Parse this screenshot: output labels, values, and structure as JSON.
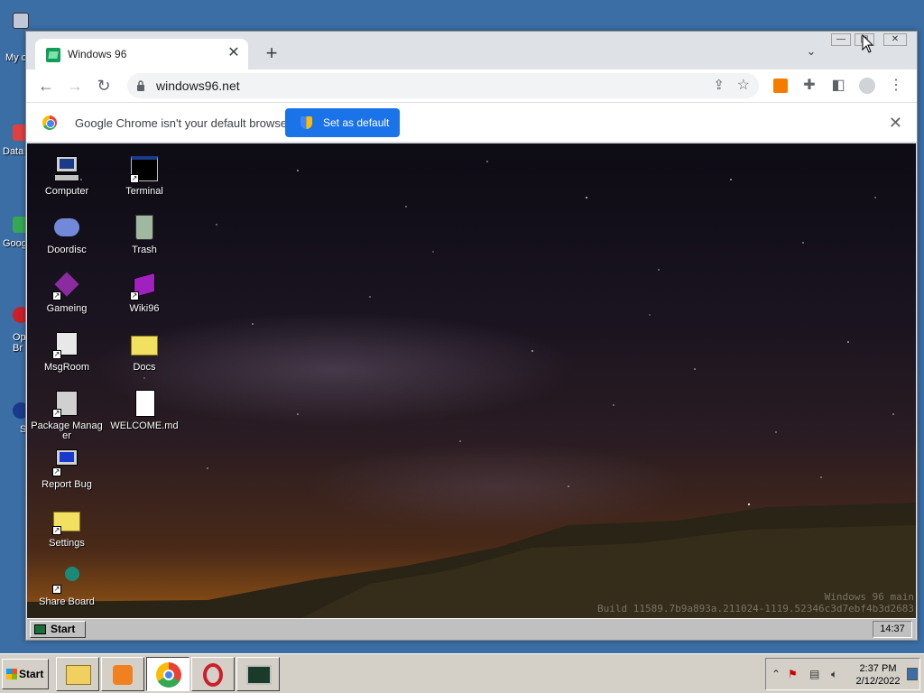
{
  "host_desktop": {
    "icons": [
      {
        "label": "My c"
      },
      {
        "label": "Data"
      },
      {
        "label": "Goog"
      },
      {
        "label": "Op\nBr"
      },
      {
        "label": "S"
      }
    ]
  },
  "browser": {
    "tab": {
      "title": "Windows 96"
    },
    "address": {
      "url": "windows96.net"
    },
    "infobar": {
      "message": "Google Chrome isn't your default browser",
      "button": "Set as default"
    }
  },
  "w96": {
    "icons": [
      {
        "label": "Computer"
      },
      {
        "label": "Terminal"
      },
      {
        "label": "Doordisc"
      },
      {
        "label": "Trash"
      },
      {
        "label": "Gameing"
      },
      {
        "label": "Wiki96"
      },
      {
        "label": "MsgRoom"
      },
      {
        "label": "Docs"
      },
      {
        "label": "Package Manager"
      },
      {
        "label": "WELCOME.md"
      },
      {
        "label": "Report Bug"
      },
      {
        "label": "Settings"
      },
      {
        "label": "Share Board"
      }
    ],
    "build_line1": "Windows 96 main",
    "build_line2": "Build 11589.7b9a893a.211024-1119.52346c3d7ebf4b3d2683",
    "taskbar": {
      "start": "Start",
      "clock": "14:37"
    }
  },
  "host_taskbar": {
    "start": "Start",
    "time": "2:37 PM",
    "date": "2/12/2022"
  },
  "colors": {
    "accent": "#1a73e8",
    "host_desktop": "#3a6ea5",
    "w96_taskbar": "#c0c0c0"
  }
}
